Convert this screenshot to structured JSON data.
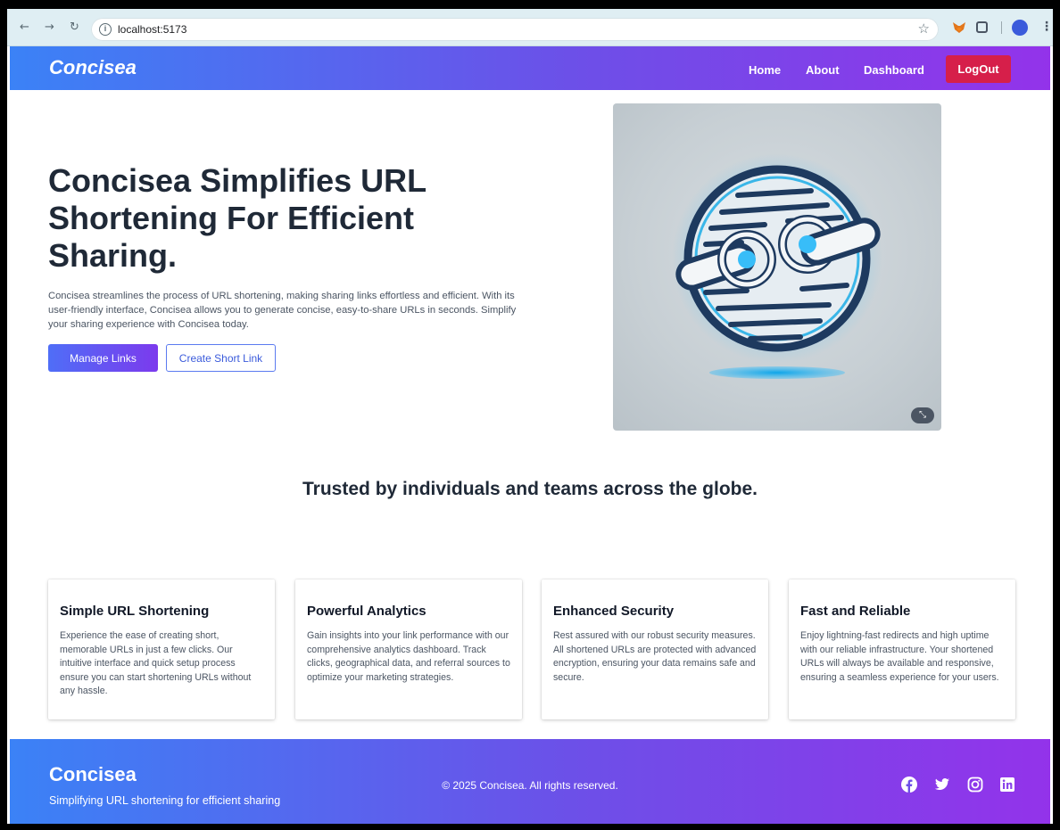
{
  "browser": {
    "url": "localhost:5173"
  },
  "navbar": {
    "brand": "Concisea",
    "links": [
      "Home",
      "About",
      "Dashboard"
    ],
    "logout": "LogOut"
  },
  "hero": {
    "title": "Concisea Simplifies URL Shortening For Efficient Sharing.",
    "description": "Concisea streamlines the process of URL shortening, making sharing links effortless and efficient. With its user-friendly interface, Concisea allows you to generate concise, easy-to-share URLs in seconds. Simplify your sharing experience with Concisea today.",
    "primary_button": "Manage Links",
    "secondary_button": "Create Short Link"
  },
  "trusted": "Trusted by individuals and teams across the globe.",
  "features": [
    {
      "title": "Simple URL Shortening",
      "text": "Experience the ease of creating short, memorable URLs in just a few clicks. Our intuitive interface and quick setup process ensure you can start shortening URLs without any hassle."
    },
    {
      "title": "Powerful Analytics",
      "text": "Gain insights into your link performance with our comprehensive analytics dashboard. Track clicks, geographical data, and referral sources to optimize your marketing strategies."
    },
    {
      "title": "Enhanced Security",
      "text": "Rest assured with our robust security measures. All shortened URLs are protected with advanced encryption, ensuring your data remains safe and secure."
    },
    {
      "title": "Fast and Reliable",
      "text": "Enjoy lightning-fast redirects and high uptime with our reliable infrastructure. Your shortened URLs will always be available and responsive, ensuring a seamless experience for your users."
    }
  ],
  "footer": {
    "brand": "Concisea",
    "tagline": "Simplifying URL shortening for efficient sharing",
    "copyright": "© 2025 Concisea. All rights reserved.",
    "social_icons": [
      "facebook-icon",
      "twitter-icon",
      "instagram-icon",
      "linkedin-icon"
    ]
  },
  "colors": {
    "gradient_start": "#3b82f6",
    "gradient_end": "#9333ea",
    "logout": "#d61f4a"
  }
}
